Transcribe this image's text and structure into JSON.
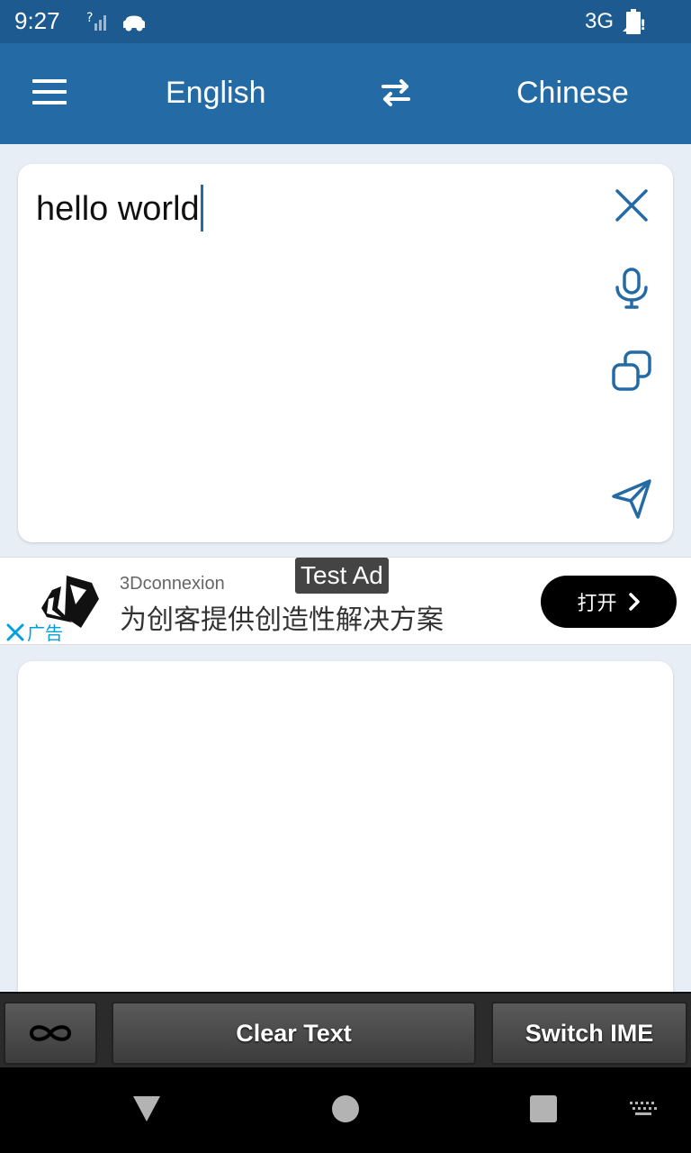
{
  "status_bar": {
    "time": "9:27",
    "network": "3G",
    "icons": [
      "signal-unknown-icon",
      "car-icon",
      "signal-icon",
      "battery-icon"
    ]
  },
  "app_bar": {
    "source_language": "English",
    "target_language": "Chinese",
    "icons": [
      "menu-icon",
      "swap-icon"
    ]
  },
  "input": {
    "value": "hello world",
    "icons": [
      "close-icon",
      "microphone-icon",
      "copy-icon",
      "send-icon"
    ]
  },
  "ad": {
    "badge": "Test Ad",
    "advertiser": "3Dconnexion",
    "headline": "为创客提供创造性解决方案",
    "ad_label": "广告",
    "cta": "打开",
    "icons": [
      "ad-close-icon",
      "chevron-right-icon"
    ]
  },
  "output": {
    "value": ""
  },
  "toolbar": {
    "clear_label": "Clear Text",
    "ime_label": "Switch IME",
    "icons": [
      "infinity-icon"
    ]
  },
  "nav": {
    "icons": [
      "back-icon",
      "home-icon",
      "recents-icon",
      "keyboard-icon"
    ]
  },
  "colors": {
    "status_bar": "#1d5a8f",
    "app_bar": "#246ba6",
    "background": "#e8eef5",
    "accent": "#246ba6",
    "ad_close": "#00a0d8"
  }
}
